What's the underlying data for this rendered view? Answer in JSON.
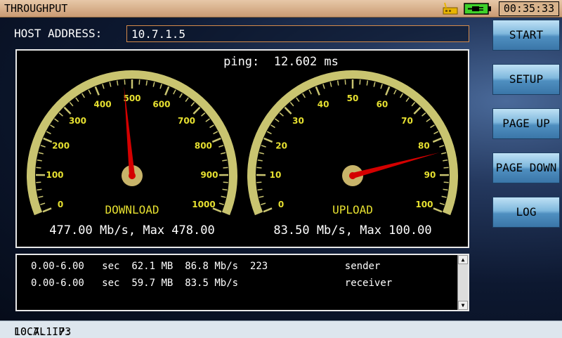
{
  "app": {
    "title": "THROUGHPUT",
    "clock": "00:35:33"
  },
  "indicators": {
    "network_icon": "network-icon",
    "battery_icon": "battery-plug-icon",
    "battery_color": "#3fd12b"
  },
  "host": {
    "label": "HOST ADDRESS:",
    "value": "10.7.1.5"
  },
  "ping": {
    "label": "ping:",
    "value": "12.602 ms"
  },
  "gauges": [
    {
      "name": "DOWNLOAD",
      "min": 0,
      "max": 1000,
      "ticks": [
        "0",
        "100",
        "200",
        "300",
        "400",
        "500",
        "600",
        "700",
        "800",
        "900",
        "1000"
      ],
      "value": 477.0,
      "readout": "477.00 Mb/s, Max 478.00"
    },
    {
      "name": "UPLOAD",
      "min": 0,
      "max": 100,
      "ticks": [
        "0",
        "10",
        "20",
        "30",
        "40",
        "50",
        "60",
        "70",
        "80",
        "90",
        "100"
      ],
      "value": 83.5,
      "readout": "83.50 Mb/s, Max 100.00"
    }
  ],
  "console": {
    "rows": [
      {
        "interval": "0.00-6.00",
        "unit": "sec",
        "transfer": "62.1 MB",
        "bitrate": "86.8 Mb/s",
        "retr": "223",
        "role": "sender"
      },
      {
        "interval": "0.00-6.00",
        "unit": "sec",
        "transfer": "59.7 MB",
        "bitrate": "83.5 Mb/s",
        "retr": "",
        "role": "receiver"
      }
    ]
  },
  "buttons": {
    "start": "START",
    "setup": "SETUP",
    "page_up": "PAGE UP",
    "page_down": "PAGE DOWN",
    "log": "LOG"
  },
  "status": {
    "label": "LOCAL IP:",
    "value": "10.7.1.73"
  },
  "colors": {
    "gauge_rim": "#c9c470",
    "needle": "#d40000",
    "gauge_label": "#e6e030",
    "hub": "#c8b46a"
  }
}
